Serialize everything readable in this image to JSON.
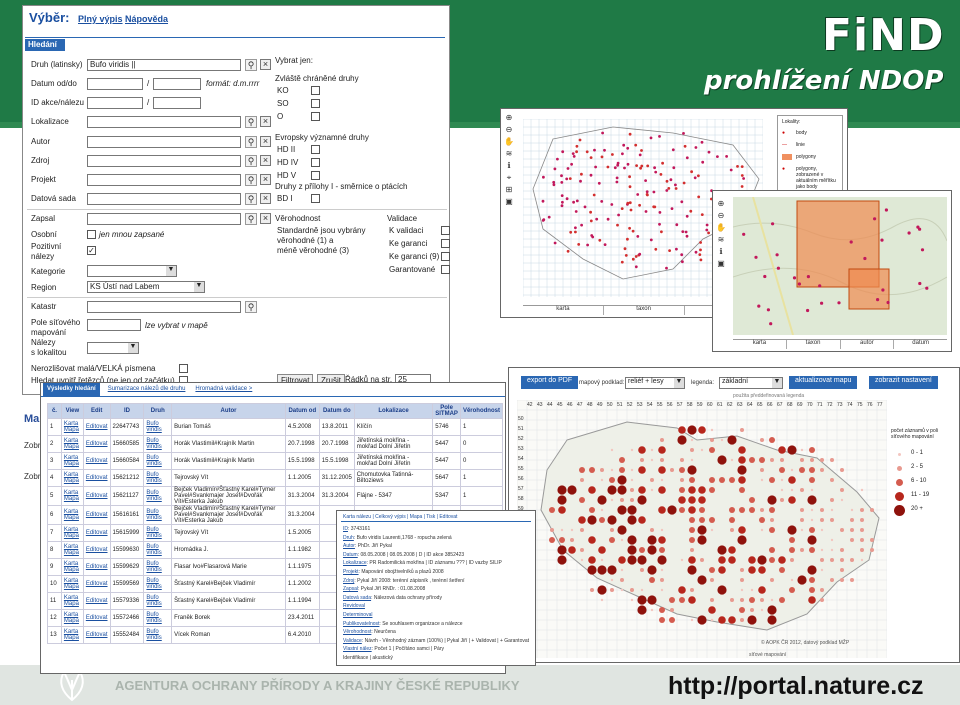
{
  "brand": {
    "title": "FiND",
    "subtitle": "prohlížení NDOP",
    "agency": "AGENTURA OCHRANY PŘÍRODY A KRAJINY ČESKÉ REPUBLIKY",
    "url": "http://portal.nature.cz"
  },
  "search": {
    "tabs": [
      "Výběr:",
      "Plný výpis",
      "Nápověda"
    ],
    "subtab": "Hledání",
    "fields": {
      "species_label": "Druh (latinsky)",
      "species_value": "Bufo viridis ||",
      "date_label": "Datum od/do",
      "date_sep": "/",
      "date_format": "formát: d.m.rrrr",
      "id_label": "ID akce/nálezu",
      "id_sep": "/",
      "locality_label": "Lokalizace",
      "author_label": "Autor",
      "source_label": "Zdroj",
      "project_label": "Projekt",
      "dataset_label": "Datová sada",
      "recorder_label": "Zapsal",
      "personal_label": "Osobní",
      "personal_note": "jen mnou zapsané",
      "positive_label1": "Pozitivní",
      "positive_label2": "nálezy",
      "category_label": "Kategorie",
      "region_label": "Region",
      "region_value": "KS Ústí nad Labem",
      "cadastre_label": "Katastr",
      "grid_label1": "Pole síťového",
      "grid_label2": "mapování",
      "grid_note": "lze vybrat v mapě",
      "finds_label1": "Nálezy",
      "finds_label2": "s lokalitou",
      "case_label": "Nerozlišovat malá/VELKÁ písmena",
      "hyphen_label": "Hledat uvnitř řetězců (ne jen od začátku)"
    },
    "only": {
      "title": "Vybrat jen:",
      "protected_title": "Zvláště chráněné druhy",
      "protected": [
        "KO",
        "SO",
        "O"
      ],
      "eu_title": "Evropsky významné druhy",
      "eu": [
        "HD II",
        "HD IV",
        "HD V"
      ],
      "birds_title": "Druhy z přílohy I - směrnice o ptácích",
      "birds": [
        "BD I"
      ]
    },
    "reliability": {
      "title": "Věrohodnost",
      "text1": "Standardně jsou vybrány",
      "text2": "věrohodné (1) a",
      "text3": "méně věrohodné (3)"
    },
    "validation": {
      "title": "Validace",
      "items": [
        "K validaci",
        "Ke garanci",
        "Ke garanci (9)",
        "Garantované"
      ]
    },
    "buttons": {
      "filter": "Filtrovat",
      "cancel": "Zrušit",
      "rows_label": "Řádků na str.",
      "rows_value": "25"
    }
  },
  "peek": {
    "ma": "Ma",
    "zob1": "Zobr",
    "zob2": "Zobr"
  },
  "results": {
    "tabs": [
      "Výsledky hledání",
      "Sumarizace nálezů dle druhu",
      "Hromadná validace >"
    ],
    "columns": [
      "č.",
      "View",
      "Edit",
      "ID",
      "Druh",
      "Autor",
      "Datum od",
      "Datum do",
      "Lokalizace",
      "Pole SITMAP",
      "Věrohodnost"
    ],
    "view_label1": "Karta",
    "view_label2": "Mapa",
    "edit_label": "Editovat",
    "rows": [
      {
        "n": "1",
        "id": "22647743",
        "druh": "Bufo viridis",
        "autor": "Burian Tomáš",
        "od": "4.5.2008",
        "do": "13.8.2011",
        "lok": "Klíčín",
        "pole": "5746",
        "ver": "1"
      },
      {
        "n": "2",
        "id": "15660585",
        "druh": "Bufo viridis",
        "autor": "Horák Vlastimil#Krajník Martin",
        "od": "20.7.1998",
        "do": "20.7.1998",
        "lok": "Jiřetínská mokřina - mokřad Dolní Jiřetín",
        "pole": "5447",
        "ver": "0"
      },
      {
        "n": "3",
        "id": "15660584",
        "druh": "Bufo viridis",
        "autor": "Horák Vlastimil#Krajník Martin",
        "od": "15.5.1998",
        "do": "15.5.1998",
        "lok": "Jiřetínská mokřina - mokřad Dolní Jiřetín",
        "pole": "5447",
        "ver": "0"
      },
      {
        "n": "4",
        "id": "15621212",
        "druh": "Bufo viridis",
        "autor": "Tejrovský Vít",
        "od": "1.1.2005",
        "do": "31.12.2005",
        "lok": "Chomutovka Tatinná-Biltoziews",
        "pole": "5647",
        "ver": "1"
      },
      {
        "n": "5",
        "id": "15621127",
        "druh": "Bufo viridis",
        "autor": "Bejček Vladimír#Šťastný Karel#Tymer Pavel#Svankmajer Josef#Dvořák Vít#Esterka Jakub",
        "od": "31.3.2004",
        "do": "31.3.2004",
        "lok": "Flájne - 5347",
        "pole": "5347",
        "ver": "1"
      },
      {
        "n": "6",
        "id": "15616161",
        "druh": "Bufo viridis",
        "autor": "Bejček Vladimír#Šťastný Karel#Tymer Pavel#Svankmajer Josef#Dvořák Vít#Esterka Jakub",
        "od": "31.3.2004",
        "do": "",
        "lok": "",
        "pole": "",
        "ver": ""
      },
      {
        "n": "7",
        "id": "15615999",
        "druh": "Bufo viridis",
        "autor": "Tejrovský Vít",
        "od": "1.5.2005",
        "do": "",
        "lok": "",
        "pole": "",
        "ver": ""
      },
      {
        "n": "8",
        "id": "15599630",
        "druh": "Bufo viridis",
        "autor": "Hromádka J.",
        "od": "1.1.1982",
        "do": "",
        "lok": "",
        "pole": "",
        "ver": ""
      },
      {
        "n": "9",
        "id": "15599629",
        "druh": "Bufo viridis",
        "autor": "Flasar Ivo#Flasarová Marie",
        "od": "1.1.1975",
        "do": "",
        "lok": "",
        "pole": "",
        "ver": ""
      },
      {
        "n": "10",
        "id": "15599569",
        "druh": "Bufo viridis",
        "autor": "Šťastný Karel#Bejček Vladimír",
        "od": "1.1.2002",
        "do": "",
        "lok": "",
        "pole": "",
        "ver": ""
      },
      {
        "n": "11",
        "id": "15579336",
        "druh": "Bufo viridis",
        "autor": "Šťastný Karel#Bejček Vladimír",
        "od": "1.1.1994",
        "do": "",
        "lok": "",
        "pole": "",
        "ver": ""
      },
      {
        "n": "12",
        "id": "15572466",
        "druh": "Bufo viridis",
        "autor": "Franěk Borek",
        "od": "23.4.2011",
        "do": "",
        "lok": "",
        "pole": "",
        "ver": ""
      },
      {
        "n": "13",
        "id": "15552484",
        "druh": "Bufo viridis",
        "autor": "Vícek Roman",
        "od": "6.4.2010",
        "do": "",
        "lok": "",
        "pole": "",
        "ver": ""
      }
    ]
  },
  "detail": {
    "tabs": "Karta nálezu | Celkový výpis | Mapa | Tisk | Editovat",
    "lines": [
      [
        "ID",
        ": 3743161"
      ],
      [
        "Druh",
        ": Bufo viridis Laurenti,1768 - ropucha zelená"
      ],
      [
        "Autor",
        ": PhDr. Jiří Pykal"
      ],
      [
        "Datum",
        ": 08.05.2008 | 08.05.2008 | D | ID akce 3852423"
      ],
      [
        "Lokalizace",
        ": PR Radomilická mokřina | ID záznamu ??? | ID vazby SILIP"
      ],
      [
        "Projekt",
        ": Mapování obojživelníků a plazů 2008"
      ],
      [
        "Zdroj",
        ": Pykal Jiří 2008: terénní zápisník , terénní šetření"
      ],
      [
        "Zapsal",
        ": Pykal Jiří RNDr. : 01.08.2008"
      ],
      [
        "Datová sada",
        ": Nálezová data ochrany přírody"
      ],
      [
        "Revidoval",
        ""
      ],
      [
        "Determinoval",
        ""
      ],
      [
        "Publikovatelnost",
        ": Se souhlasem organizace a nálezce"
      ],
      [
        "Věrohodnost",
        ": Neurčena"
      ],
      [
        "Validace",
        ": Návrh - Věrohodný záznam (100%) | Pykal Jiří | + Validovat | + Garantovat"
      ],
      [
        "Vlastní nález",
        ": Počet 1 | Počítáno samci | Páry"
      ],
      [
        "",
        "Identifikace | akustický"
      ]
    ]
  },
  "map1": {
    "tabs": [
      "karta",
      "taxon",
      "autor",
      "datum"
    ],
    "legend_title": "Lokality:",
    "legend": [
      "body",
      "linie",
      "polygony",
      "polygony, zobrazené v aktuálním měřítku jako body"
    ]
  },
  "map2": {
    "tabs": [
      "karta",
      "taxon",
      "autor",
      "datum"
    ]
  },
  "map3": {
    "toolbar": {
      "export": "export do PDF",
      "bg_label": "mapový podklad:",
      "bg_value": "reliéf + lesy",
      "legend_label": "legenda:",
      "legend_value": "základní",
      "update": "aktualizovat mapu",
      "reset": "zobrazit nastavení"
    },
    "legend_note": "použita předdefinovaná legenda",
    "legend_title": "počet záznamů v poli síťového mapování",
    "legend": [
      "0 - 1",
      "2 - 5",
      "6 - 10",
      "11 - 19",
      "20 +"
    ],
    "copyright": "© AOPK ČR 2012, datový podklad MŽP",
    "grid_caption": "síťové mapování",
    "top_axis": [
      "42",
      "43",
      "44",
      "45",
      "46",
      "47",
      "48",
      "49",
      "50",
      "51",
      "52",
      "53",
      "54",
      "55",
      "56",
      "57",
      "58",
      "59",
      "60",
      "61",
      "62",
      "63",
      "64",
      "65",
      "66",
      "67",
      "68",
      "69",
      "70",
      "71",
      "72",
      "73",
      "74",
      "75",
      "76",
      "77",
      "78"
    ],
    "left_axis": [
      "50",
      "51",
      "52",
      "53",
      "54",
      "55",
      "56",
      "57",
      "58",
      "59",
      "60",
      "61",
      "62",
      "63",
      "64",
      "65",
      "66",
      "67",
      "68",
      "69",
      "70",
      "71",
      "72",
      "73",
      "74",
      "75"
    ]
  },
  "colors": {
    "green": "#1f7a46",
    "link_blue": "#1a4fa0",
    "dot_red": "#b01b1b"
  }
}
